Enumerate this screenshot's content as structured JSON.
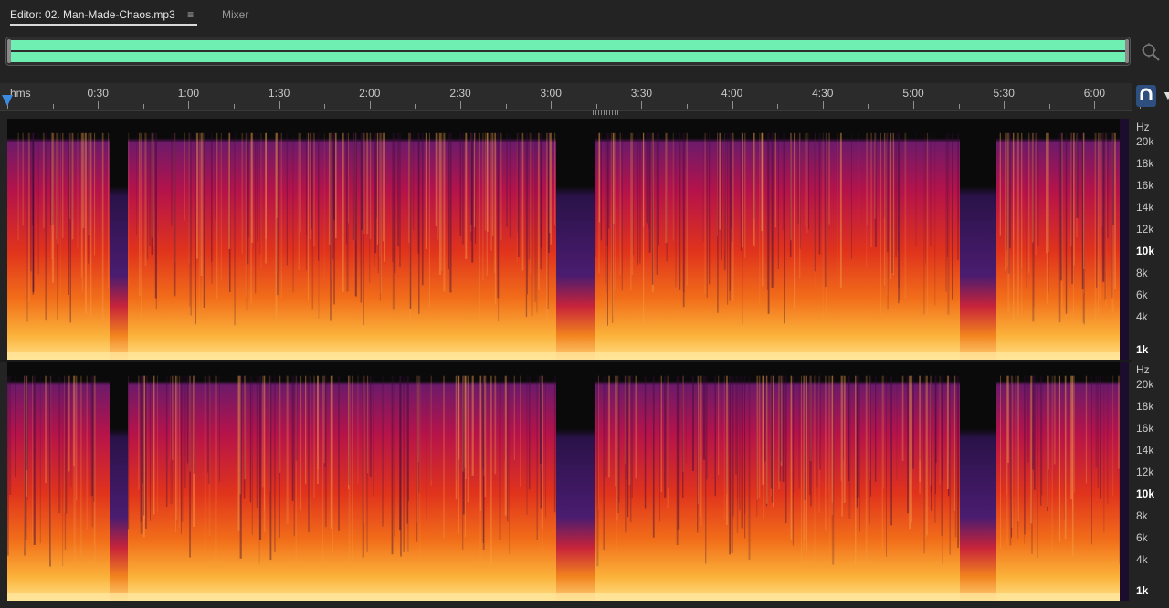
{
  "tabs": {
    "editor_label": "Editor: 02. Man-Made-Chaos.mp3",
    "menu_glyph": "≡",
    "mixer_label": "Mixer"
  },
  "colors": {
    "overview_wave": "#6ff0b2",
    "playhead": "#3d8be0",
    "accent_button": "#2e4f7e"
  },
  "ruler": {
    "unit_label": "hms",
    "labels": [
      "0:30",
      "1:00",
      "1:30",
      "2:00",
      "2:30",
      "3:00",
      "3:30",
      "4:00",
      "4:30",
      "5:00",
      "5:30",
      "6:00"
    ]
  },
  "frequency_axis": {
    "unit": "Hz",
    "labels": [
      "20k",
      "18k",
      "16k",
      "14k",
      "12k",
      "10k",
      "8k",
      "6k",
      "4k",
      "1k"
    ],
    "bold_labels": [
      "10k",
      "1k"
    ]
  },
  "icons": [
    "menu-icon",
    "zoom-icon",
    "playhead-marker",
    "snap-icon",
    "edge-icon"
  ]
}
